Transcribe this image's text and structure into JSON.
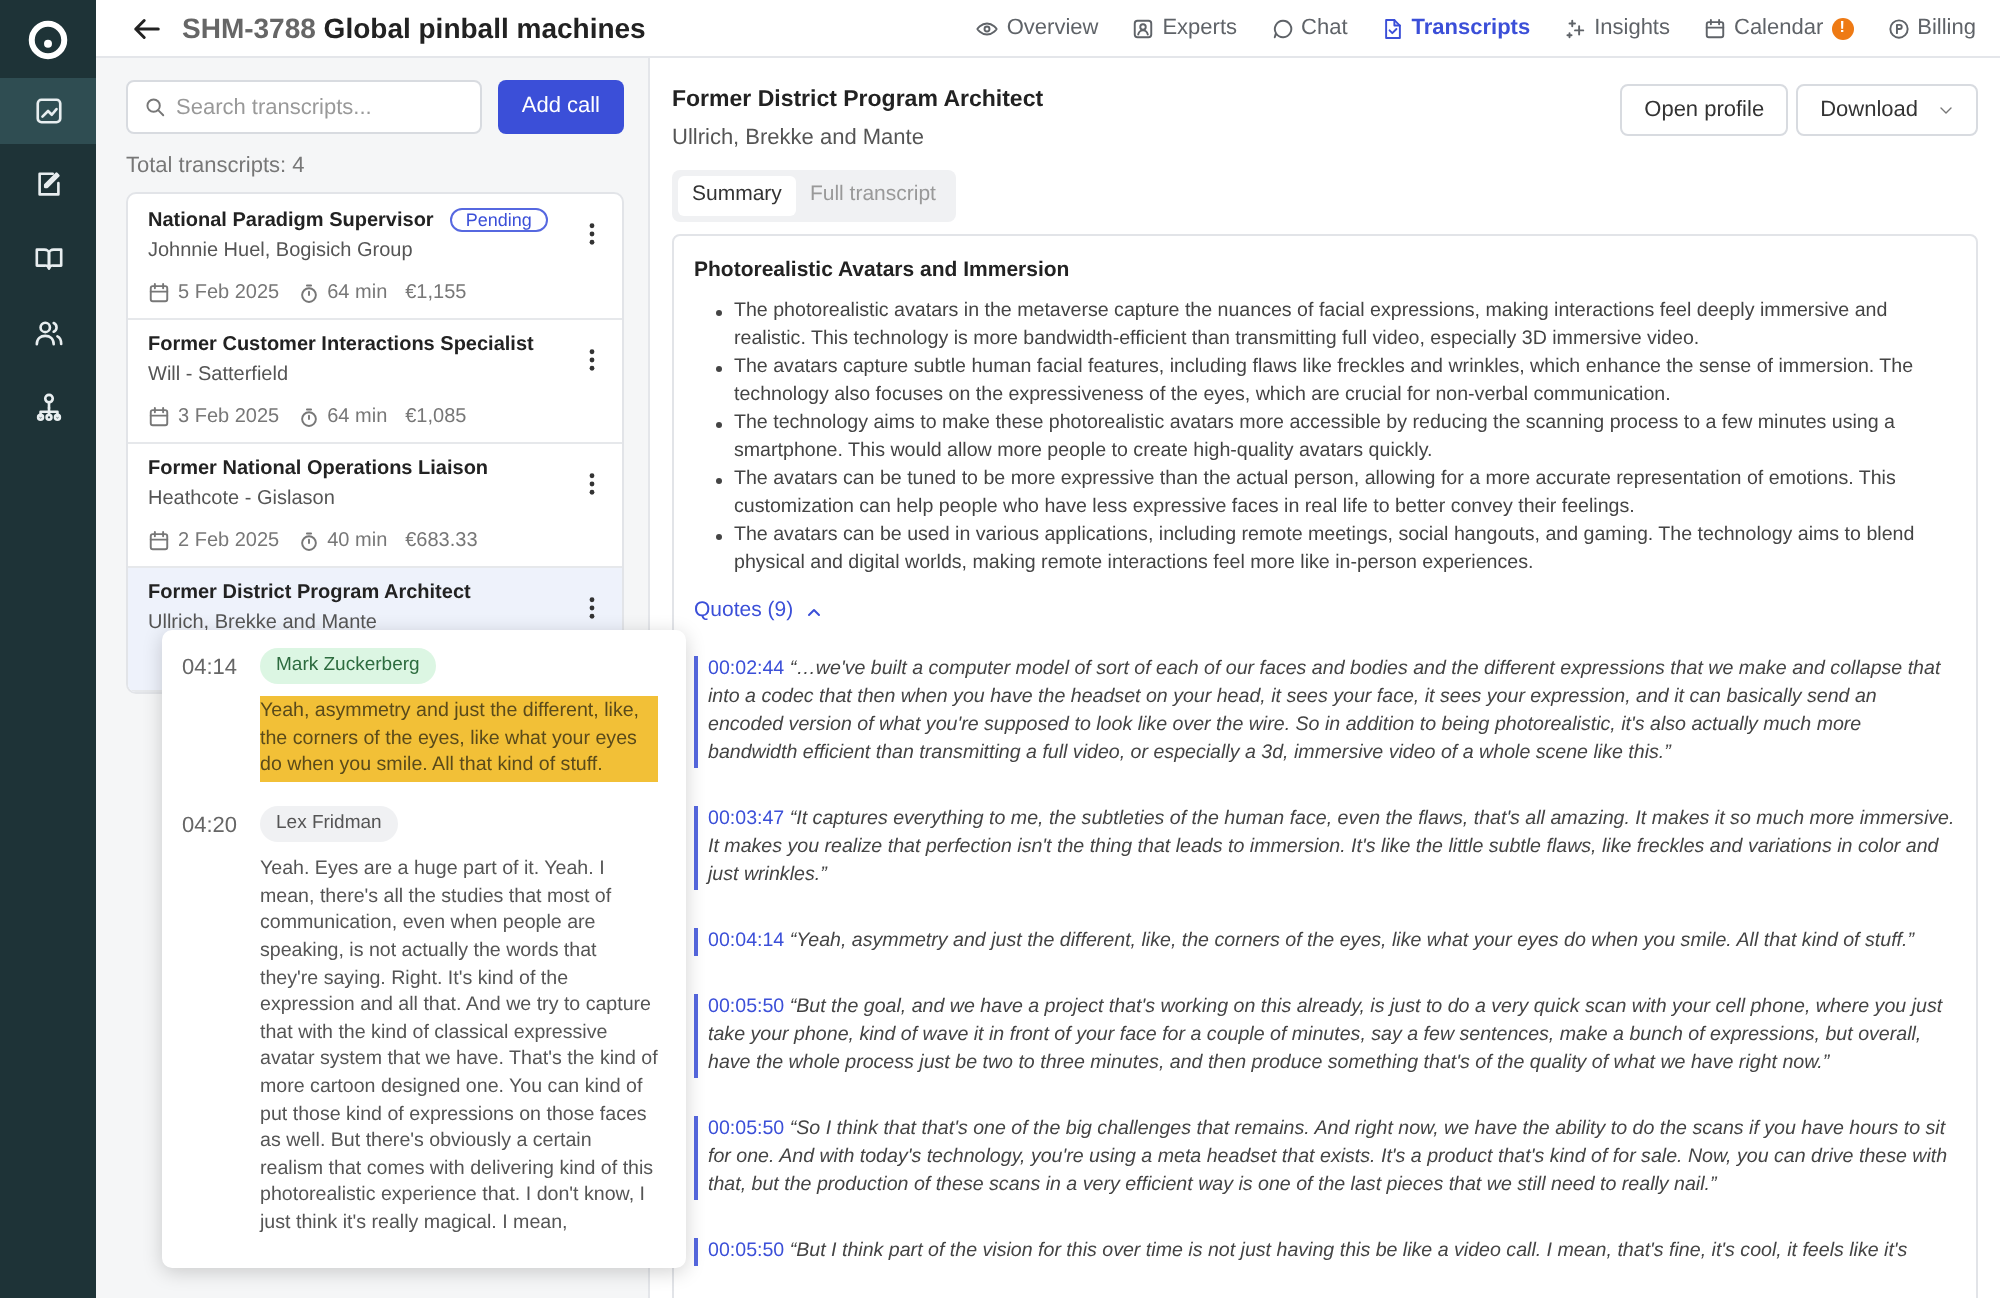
{
  "sidebar": {
    "items": [
      {
        "kind": "chart",
        "selected": true
      },
      {
        "kind": "edit",
        "selected": false
      },
      {
        "kind": "book",
        "selected": false
      },
      {
        "kind": "people",
        "selected": false
      },
      {
        "kind": "network",
        "selected": false
      }
    ]
  },
  "header": {
    "code": "SHM-3788",
    "title": "Global pinball machines"
  },
  "nav": [
    {
      "kind": "eye",
      "label": "Overview",
      "selected": false
    },
    {
      "kind": "experts",
      "label": "Experts",
      "selected": false
    },
    {
      "kind": "chat",
      "label": "Chat",
      "selected": false
    },
    {
      "kind": "doc",
      "label": "Transcripts",
      "selected": true
    },
    {
      "kind": "sparkle",
      "label": "Insights",
      "selected": false
    },
    {
      "kind": "calendar",
      "label": "Calendar",
      "selected": false,
      "badge": "!"
    },
    {
      "kind": "billing",
      "label": "Billing",
      "selected": false
    }
  ],
  "left": {
    "search": {
      "placeholder": "Search transcripts..."
    },
    "add_button": "Add call",
    "total": "Total transcripts: 4",
    "calls": [
      {
        "title": "National Paradigm Supervisor",
        "badge": "Pending",
        "subtitle": "Johnnie Huel, Bogisich Group",
        "date": "5 Feb 2025",
        "duration": "64 min",
        "price": "€1,155",
        "selected": false
      },
      {
        "title": "Former Customer Interactions Specialist",
        "subtitle": "Will - Satterfield",
        "date": "3 Feb 2025",
        "duration": "64 min",
        "price": "€1,085",
        "selected": false
      },
      {
        "title": "Former National Operations Liaison",
        "subtitle": "Heathcote - Gislason",
        "date": "2 Feb 2025",
        "duration": "40 min",
        "price": "€683.33",
        "selected": false
      },
      {
        "title": "Former District Program Architect",
        "subtitle": "Ullrich, Brekke and Mante",
        "selected": true
      }
    ]
  },
  "popover": {
    "entries": [
      {
        "time": "04:14",
        "speaker": "Mark Zuckerberg",
        "highlighted": true,
        "text": "Yeah, asymmetry and just the different, like, the corners of the eyes, like what your eyes do when you smile. All that kind of stuff."
      },
      {
        "time": "04:20",
        "speaker": "Lex Fridman",
        "highlighted": false,
        "text": "Yeah. Eyes are a huge part of it. Yeah. I mean, there's all the studies that most of communication, even when people are speaking, is not actually the words that they're saying. Right. It's kind of the expression and all that. And we try to capture that with the kind of classical expressive avatar system that we have. That's the kind of more cartoon designed one. You can kind of put those kind of expressions on those faces as well. But there's obviously a certain realism that comes with delivering kind of this photorealistic experience that. I don't know, I just think it's really magical. I mean,"
      }
    ]
  },
  "detail": {
    "title": "Former District Program Architect",
    "subtitle": "Ullrich, Brekke and Mante",
    "buttons": [
      {
        "kind": "plain",
        "label": "Open profile"
      },
      {
        "kind": "dropdown",
        "label": "Download"
      }
    ],
    "tabs": [
      {
        "label": "Summary",
        "selected": true
      },
      {
        "label": "Full transcript",
        "selected": false
      }
    ],
    "section_title": "Photorealistic Avatars and Immersion",
    "bullets": [
      "The photorealistic avatars in the metaverse capture the nuances of facial expressions, making interactions feel deeply immersive and realistic. This technology is more bandwidth-efficient than transmitting full video, especially 3D immersive video.",
      "The avatars capture subtle human facial features, including flaws like freckles and wrinkles, which enhance the sense of immersion. The technology also focuses on the expressiveness of the eyes, which are crucial for non-verbal communication.",
      "The technology aims to make these photorealistic avatars more accessible by reducing the scanning process to a few minutes using a smartphone. This would allow more people to create high-quality avatars quickly.",
      "The avatars can be tuned to be more expressive than the actual person, allowing for a more accurate representation of emotions. This customization can help people who have less expressive faces in real life to better convey their feelings.",
      "The avatars can be used in various applications, including remote meetings, social hangouts, and gaming. The technology aims to blend physical and digital worlds, making remote interactions feel more like in-person experiences."
    ],
    "quotes_toggle": {
      "label": "Quotes (9)",
      "expanded": true
    },
    "quotes": [
      {
        "time": "00:02:44",
        "text": "“…we've built a computer model of sort of each of our faces and bodies and the different expressions that we make and collapse that into a codec that then when you have the headset on your head, it sees your face, it sees your expression, and it can basically send an encoded version of what you're supposed to look like over the wire. So in addition to being photorealistic, it's also actually much more bandwidth efficient than transmitting a full video, or especially a 3d, immersive video of a whole scene like this.”"
      },
      {
        "time": "00:03:47",
        "text": "“It captures everything to me, the subtleties of the human face, even the flaws, that's all amazing. It makes it so much more immersive. It makes you realize that perfection isn't the thing that leads to immersion. It's like the little subtle flaws, like freckles and variations in color and just wrinkles.”"
      },
      {
        "time": "00:04:14",
        "text": "“Yeah, asymmetry and just the different, like, the corners of the eyes, like what your eyes do when you smile. All that kind of stuff.”"
      },
      {
        "time": "00:05:50",
        "text": "“But the goal, and we have a project that's working on this already, is just to do a very quick scan with your cell phone, where you just take your phone, kind of wave it in front of your face for a couple of minutes, say a few sentences, make a bunch of expressions, but overall, have the whole process just be two to three minutes, and then produce something that's of the quality of what we have right now.”"
      },
      {
        "time": "00:05:50",
        "text": "“So I think that that's one of the big challenges that remains. And right now, we have the ability to do the scans if you have hours to sit for one. And with today's technology, you're using a meta headset that exists. It's a product that's kind of for sale. Now, you can drive these with that, but the production of these scans in a very efficient way is one of the last pieces that we still need to really nail.”"
      },
      {
        "time": "00:05:50",
        "text": "“But I think part of the vision for this over time is not just having this be like a video call. I mean, that's fine, it's cool, it feels like it's"
      }
    ]
  }
}
